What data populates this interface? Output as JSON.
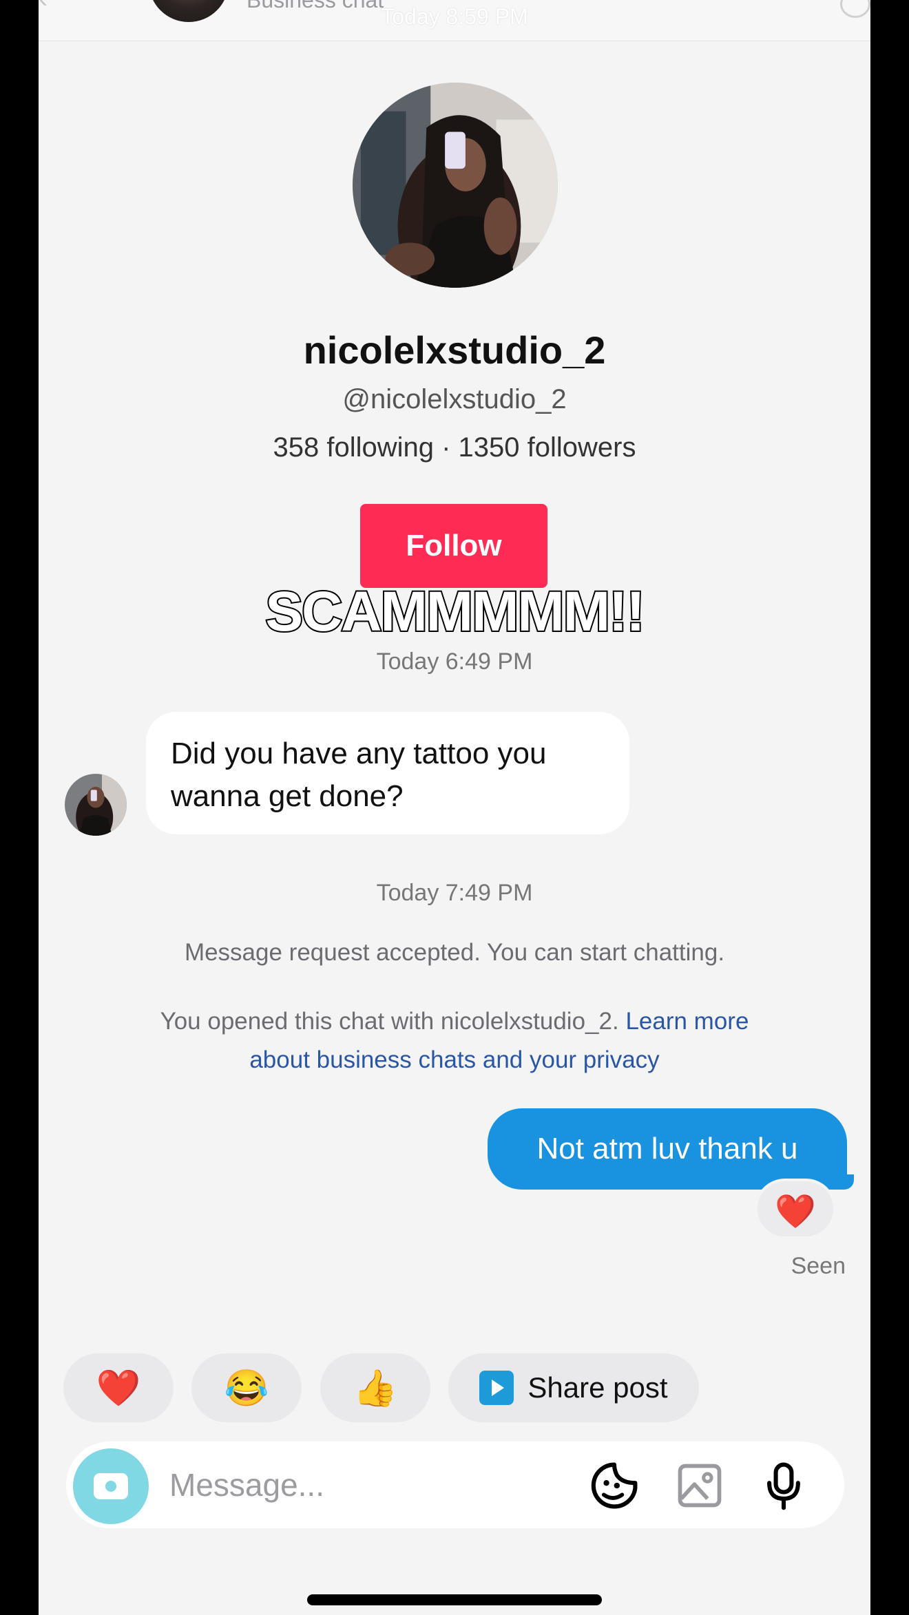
{
  "header": {
    "subtitle": "Business chat",
    "video_time_overlay": "Today 8:59 PM"
  },
  "profile": {
    "name": "nicolelxstudio_2",
    "handle": "@nicolelxstudio_2",
    "stats": "358 following · 1350 followers",
    "follow_label": "Follow"
  },
  "caption": "SCAMMMMM!!",
  "chat": {
    "time_1": "Today 6:49 PM",
    "incoming_message": "Did you have any tattoo you wanna get done?",
    "time_2": "Today 7:49 PM",
    "system_message": "Message request accepted. You can start chatting.",
    "privacy_text": "You opened this chat with nicolelxstudio_2.",
    "privacy_link": "Learn more about business chats and your privacy",
    "outgoing_message": "Not atm luv thank u",
    "reaction": "❤️",
    "seen_label": "Seen"
  },
  "quick_replies": {
    "heart": "❤️",
    "laugh": "😂",
    "thumbs": "👍",
    "share_label": "Share post"
  },
  "composer": {
    "placeholder": "Message..."
  },
  "colors": {
    "follow": "#fe2c55",
    "outgoing_bubble": "#1993e0",
    "link": "#2a56a6",
    "camera": "#7fd8e4"
  },
  "icons": [
    "back-icon",
    "camera-icon",
    "sticker-icon",
    "image-icon",
    "mic-icon",
    "play-icon"
  ]
}
